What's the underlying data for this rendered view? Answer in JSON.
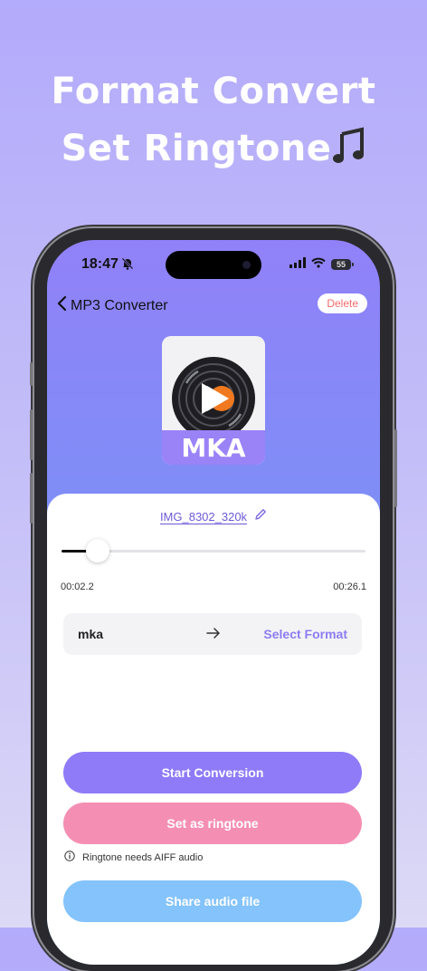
{
  "headline": {
    "line1": "Format Convert",
    "line2": "Set Ringtone"
  },
  "status_bar": {
    "time": "18:47",
    "battery": "55"
  },
  "nav": {
    "title": "MP3 Converter",
    "delete_label": "Delete"
  },
  "cover": {
    "format_label": "MKA"
  },
  "file": {
    "name": "IMG_8302_320k"
  },
  "player": {
    "current_time": "00:02.2",
    "total_time": "00:26.1",
    "progress": 0.085
  },
  "conversion": {
    "source_format": "mka",
    "select_label": "Select Format"
  },
  "actions": {
    "start": "Start Conversion",
    "ringtone": "Set as ringtone",
    "ringtone_note": "Ringtone needs AIFF audio",
    "share": "Share audio file"
  },
  "colors": {
    "start": "#8f7bf8",
    "ringtone": "#f48fb3",
    "share": "#84c3fb",
    "accent": "#8c7cf2"
  }
}
